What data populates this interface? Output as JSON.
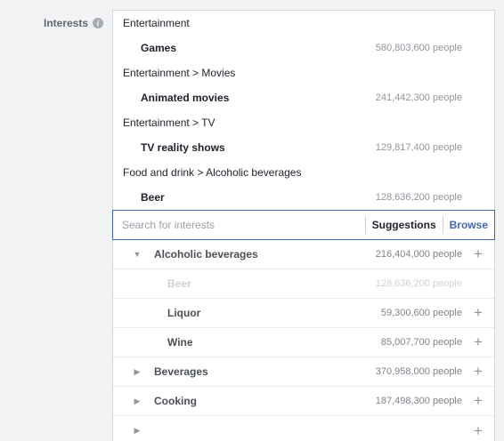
{
  "field": {
    "label": "Interests",
    "info_glyph": "i"
  },
  "selected_interests": [
    {
      "category": "Entertainment",
      "name": "Games",
      "audience": "580,803,600 people"
    },
    {
      "category": "Entertainment > Movies",
      "name": "Animated movies",
      "audience": "241,442,300 people"
    },
    {
      "category": "Entertainment > TV",
      "name": "TV reality shows",
      "audience": "129,817,400 people"
    },
    {
      "category": "Food and drink > Alcoholic beverages",
      "name": "Beer",
      "audience": "128,636,200 people"
    }
  ],
  "search": {
    "placeholder": "Search for interests",
    "value": "",
    "suggestions_label": "Suggestions",
    "browse_label": "Browse"
  },
  "browse_list": [
    {
      "name": "Alcoholic beverages",
      "audience": "216,404,000 people",
      "expanded": true,
      "level": 1,
      "disabled": false,
      "caret": "▼",
      "plus": "+"
    },
    {
      "name": "Beer",
      "audience": "128,636,200 people",
      "level": 2,
      "disabled": true,
      "caret": "",
      "plus": "+"
    },
    {
      "name": "Liquor",
      "audience": "59,300,600 people",
      "level": 2,
      "disabled": false,
      "caret": "",
      "plus": "+"
    },
    {
      "name": "Wine",
      "audience": "85,007,700 people",
      "level": 2,
      "disabled": false,
      "caret": "",
      "plus": "+"
    },
    {
      "name": "Beverages",
      "audience": "370,958,000 people",
      "level": 1,
      "disabled": false,
      "caret": "▶",
      "plus": "+"
    },
    {
      "name": "Cooking",
      "audience": "187,498,300 people",
      "level": 1,
      "disabled": false,
      "caret": "▶",
      "plus": "+"
    },
    {
      "name": "",
      "audience": "",
      "level": 1,
      "disabled": false,
      "caret": "▶",
      "plus": "+"
    }
  ],
  "colors": {
    "accent": "#4267b2",
    "page_bg": "#f2f3f5",
    "muted": "#90949c"
  }
}
